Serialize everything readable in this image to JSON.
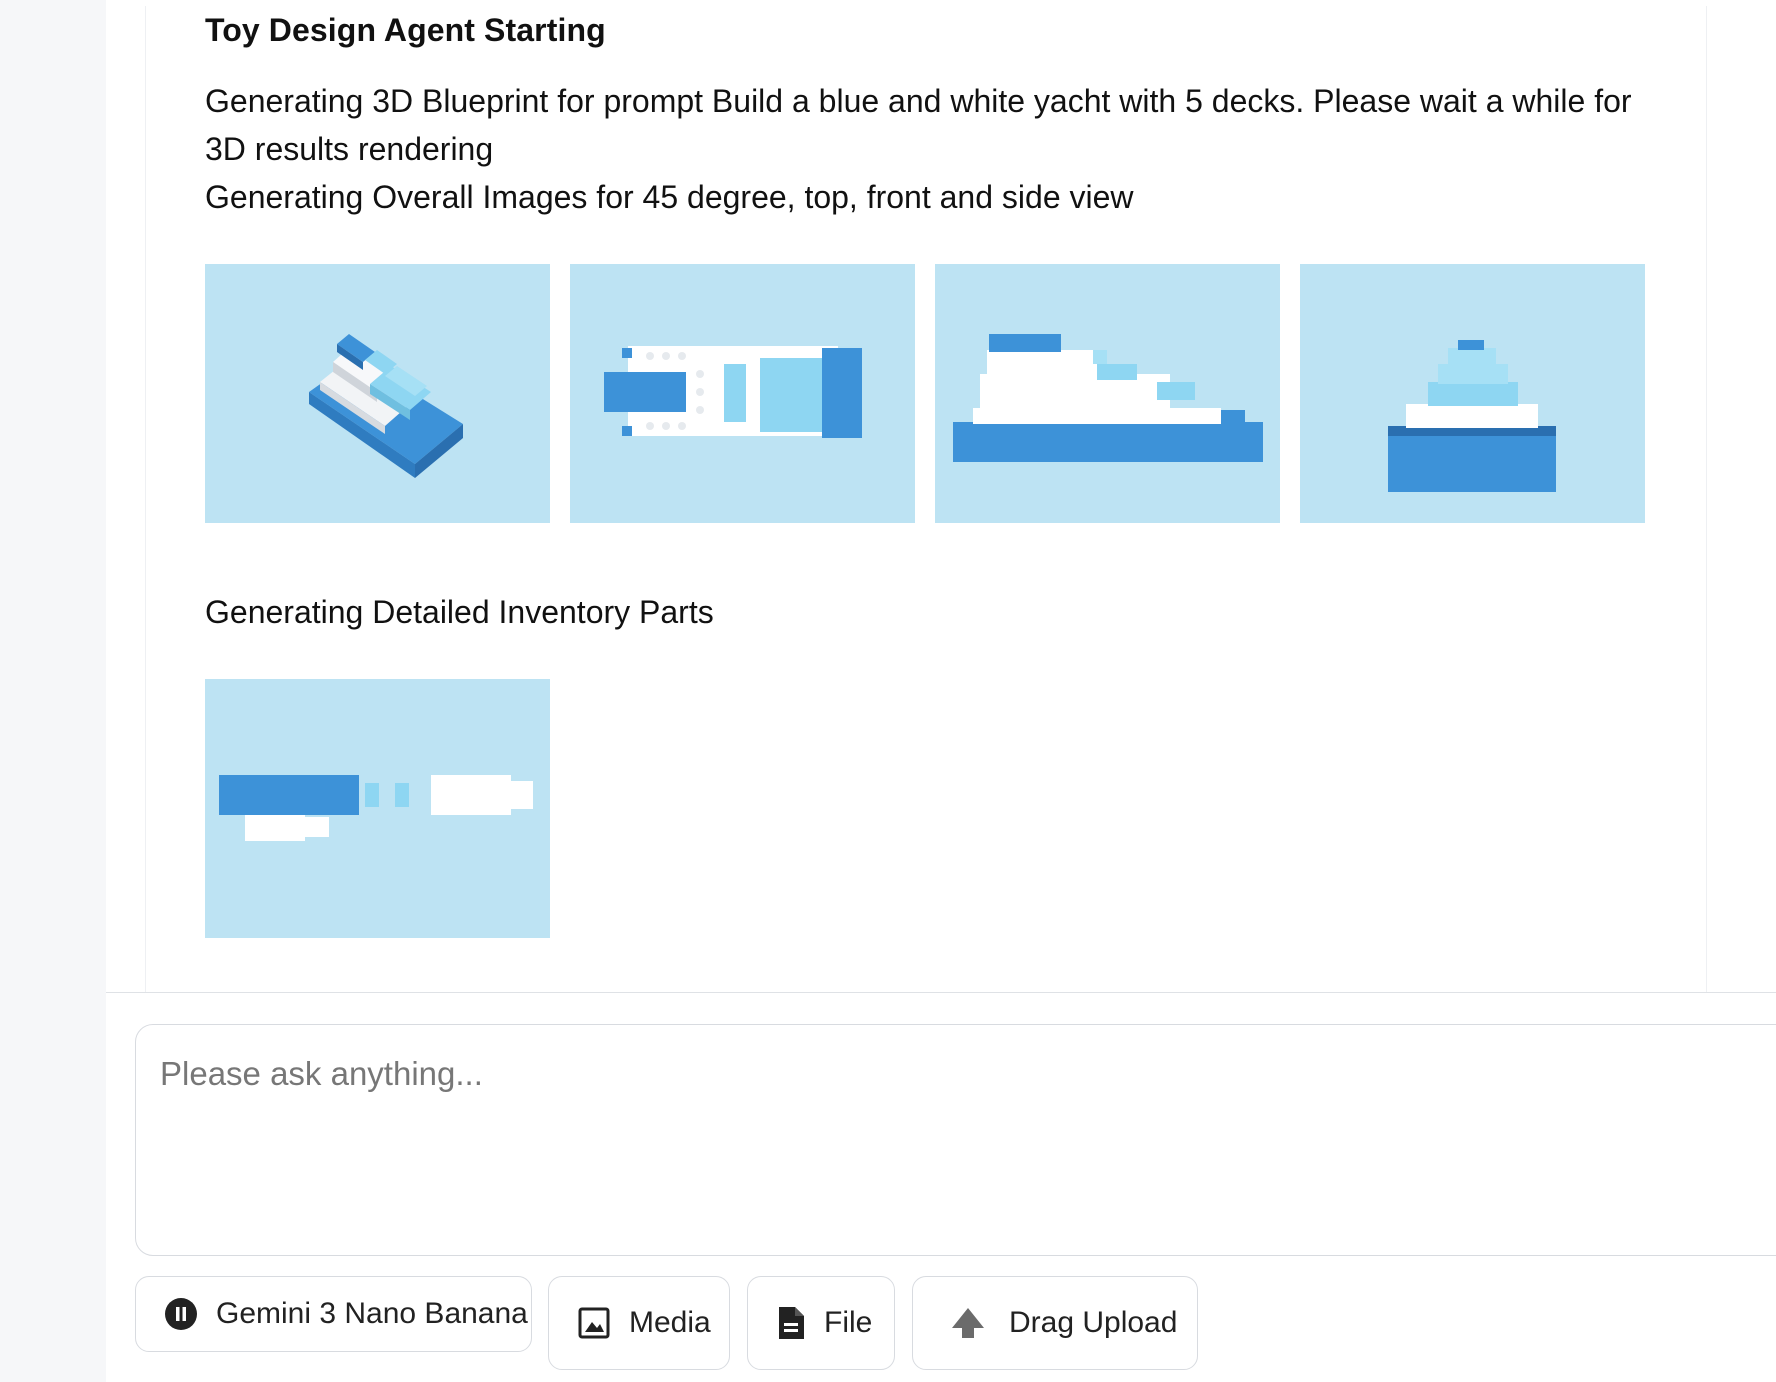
{
  "message": {
    "title": "Toy Design Agent Starting",
    "line1": "Generating 3D Blueprint for prompt Build a blue and white yacht with 5 decks. Please wait a while for 3D results rendering",
    "line2": "Generating Overall Images for 45 degree, top, front and side view",
    "line3": "Generating Detailed Inventory Parts"
  },
  "views": {
    "count": 4,
    "background_color": "#bde3f3",
    "blue": "#3d92d8",
    "light_blue": "#8ed6f2",
    "white": "#ffffff"
  },
  "composer": {
    "placeholder": "Please ask anything..."
  },
  "toolbar": {
    "model_label": "Gemini 3 Nano Banana",
    "media_label": "Media",
    "file_label": "File",
    "drag_upload_label": "Drag Upload",
    "icons": [
      "pause-icon",
      "image-icon",
      "document-icon",
      "upload-arrow-icon"
    ]
  }
}
